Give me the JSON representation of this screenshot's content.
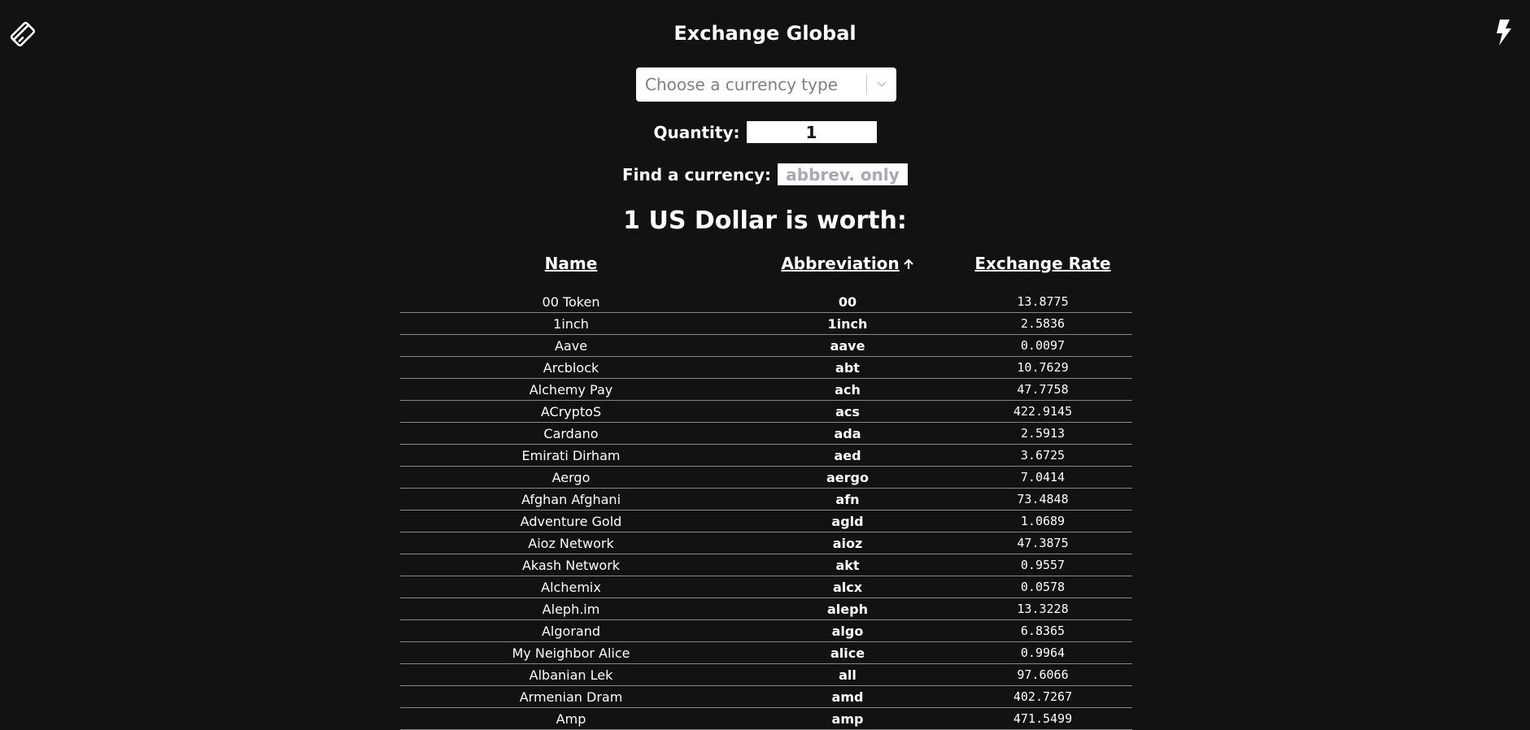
{
  "app": {
    "title": "Exchange Global",
    "left_icon": "ticket-icon",
    "right_icon": "bolt-icon"
  },
  "currency_select": {
    "placeholder": "Choose a currency type",
    "arrow_icon": "chevron-down-icon"
  },
  "quantity": {
    "label": "Quantity:",
    "value": "1"
  },
  "find": {
    "label": "Find a currency:",
    "placeholder": "abbrev. only"
  },
  "heading": "1 US Dollar is worth:",
  "table": {
    "columns": {
      "name": "Name",
      "abbreviation": "Abbreviation",
      "rate": "Exchange Rate"
    },
    "sort": {
      "column": "abbreviation",
      "direction": "ascending",
      "icon": "arrow-up-icon"
    },
    "rows": [
      {
        "name": "00 Token",
        "abbr": "00",
        "rate": "13.8775"
      },
      {
        "name": "1inch",
        "abbr": "1inch",
        "rate": "2.5836"
      },
      {
        "name": "Aave",
        "abbr": "aave",
        "rate": "0.0097"
      },
      {
        "name": "Arcblock",
        "abbr": "abt",
        "rate": "10.7629"
      },
      {
        "name": "Alchemy Pay",
        "abbr": "ach",
        "rate": "47.7758"
      },
      {
        "name": "ACryptoS",
        "abbr": "acs",
        "rate": "422.9145"
      },
      {
        "name": "Cardano",
        "abbr": "ada",
        "rate": "2.5913"
      },
      {
        "name": "Emirati Dirham",
        "abbr": "aed",
        "rate": "3.6725"
      },
      {
        "name": "Aergo",
        "abbr": "aergo",
        "rate": "7.0414"
      },
      {
        "name": "Afghan Afghani",
        "abbr": "afn",
        "rate": "73.4848"
      },
      {
        "name": "Adventure Gold",
        "abbr": "agld",
        "rate": "1.0689"
      },
      {
        "name": "Aioz Network",
        "abbr": "aioz",
        "rate": "47.3875"
      },
      {
        "name": "Akash Network",
        "abbr": "akt",
        "rate": "0.9557"
      },
      {
        "name": "Alchemix",
        "abbr": "alcx",
        "rate": "0.0578"
      },
      {
        "name": "Aleph.im",
        "abbr": "aleph",
        "rate": "13.3228"
      },
      {
        "name": "Algorand",
        "abbr": "algo",
        "rate": "6.8365"
      },
      {
        "name": "My Neighbor Alice",
        "abbr": "alice",
        "rate": "0.9964"
      },
      {
        "name": "Albanian Lek",
        "abbr": "all",
        "rate": "97.6066"
      },
      {
        "name": "Armenian Dram",
        "abbr": "amd",
        "rate": "402.7267"
      },
      {
        "name": "Amp",
        "abbr": "amp",
        "rate": "471.5499"
      }
    ]
  }
}
